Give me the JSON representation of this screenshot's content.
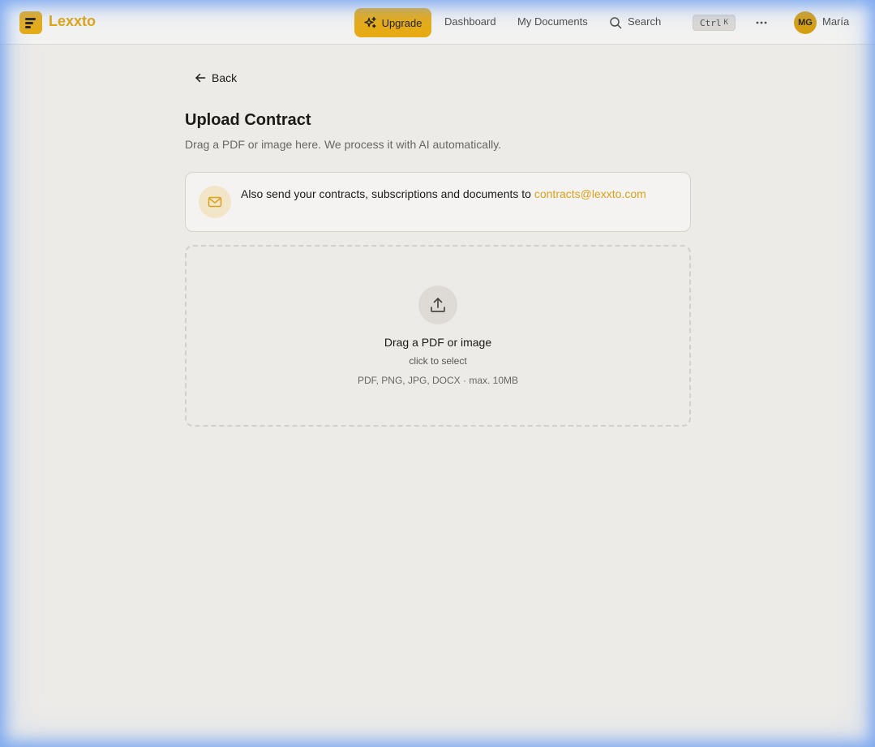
{
  "nav": {
    "brand": "Lexxto",
    "upgrade_label": "Upgrade",
    "links": [
      "Dashboard",
      "My Documents"
    ],
    "search_label": "Search",
    "shortcut_key1": "Ctrl",
    "shortcut_key2": "K",
    "user_initials": "MG",
    "user_name": "María"
  },
  "page": {
    "back_label": "Back",
    "title": "Upload Contract",
    "subtitle": "Drag a PDF or image here. We process it with AI automatically."
  },
  "email_card": {
    "text": "Also send your contracts, subscriptions and documents to ",
    "email": "contracts@lexxto.com"
  },
  "dropzone": {
    "title": "Drag a PDF or image",
    "subtitle": "click to select",
    "formats": "PDF, PNG, JPG, DOCX · max. 10MB"
  },
  "colors": {
    "accent": "#e8aa10",
    "link": "#d9a21a",
    "background": "#edebe8"
  },
  "icons": [
    "menu-icon",
    "sparkle-icon",
    "search-icon",
    "more-icon",
    "arrow-left-icon",
    "mail-icon",
    "upload-icon"
  ]
}
